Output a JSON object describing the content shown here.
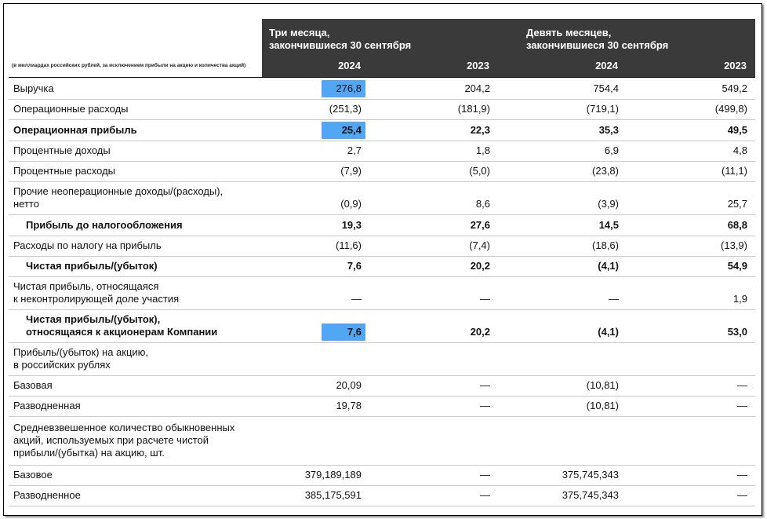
{
  "header": {
    "period_three_months": "Три месяца,\nзакончившиеся 30 сентября",
    "period_nine_months": "Девять месяцев,\nзакончившиеся 30 сентября",
    "years": [
      "2024",
      "2023",
      "2024",
      "2023"
    ],
    "unit_note": "(в миллиардах российских рублей, за исключением прибыли на акцию и количества акций)"
  },
  "highlight_color": "#52a7f5",
  "rows": [
    {
      "label": "Выручка",
      "values": [
        "276,8",
        "204,2",
        "754,4",
        "549,2"
      ],
      "highlight": true
    },
    {
      "label": "Операционные расходы",
      "values": [
        "(251,3)",
        "(181,9)",
        "(719,1)",
        "(499,8)"
      ]
    },
    {
      "label": "Операционная прибыль",
      "values": [
        "25,4",
        "22,3",
        "35,3",
        "49,5"
      ],
      "bold": true,
      "highlight": true
    },
    {
      "label": "Процентные доходы",
      "values": [
        "2,7",
        "1,8",
        "6,9",
        "4,8"
      ]
    },
    {
      "label": "Процентные расходы",
      "values": [
        "(7,9)",
        "(5,0)",
        "(23,8)",
        "(11,1)"
      ]
    },
    {
      "label": "Прочие неоперационные доходы/(расходы),\nнетто",
      "values": [
        "(0,9)",
        "8,6",
        "(3,9)",
        "25,7"
      ]
    },
    {
      "label": "Прибыль до налогообложения",
      "values": [
        "19,3",
        "27,6",
        "14,5",
        "68,8"
      ],
      "bold": true,
      "indent": true
    },
    {
      "label": "Расходы по налогу на прибыль",
      "values": [
        "(11,6)",
        "(7,4)",
        "(18,6)",
        "(13,9)"
      ]
    },
    {
      "label": "Чистая прибыль/(убыток)",
      "values": [
        "7,6",
        "20,2",
        "(4,1)",
        "54,9"
      ],
      "bold": true,
      "indent": true
    },
    {
      "label": "Чистая прибыль, относящаяся\nк неконтролирующей доле участия",
      "values": [
        "—",
        "—",
        "—",
        "1,9"
      ]
    },
    {
      "label": "Чистая прибыль/(убыток),\nотносящаяся к акционерам Компании",
      "values": [
        "7,6",
        "20,2",
        "(4,1)",
        "53,0"
      ],
      "bold": true,
      "indent": true,
      "highlight": true
    },
    {
      "label": "Прибыль/(убыток) на акцию,\nв российских рублях",
      "values": [
        "",
        "",
        "",
        ""
      ]
    },
    {
      "label": "Базовая",
      "values": [
        "20,09",
        "—",
        "(10,81)",
        "—"
      ]
    },
    {
      "label": "Разводненная",
      "values": [
        "19,78",
        "—",
        "(10,81)",
        "—"
      ]
    },
    {
      "label": "Средневзвешенное количество обыкновенных\nакций, используемых при расчете чистой\nприбыли/(убытка) на акцию, шт.",
      "values": [
        "",
        "",
        "",
        ""
      ]
    },
    {
      "label": "Базовое",
      "values": [
        "379,189,189",
        "—",
        "375,745,343",
        "—"
      ]
    },
    {
      "label": "Разводненное",
      "values": [
        "385,175,591",
        "—",
        "375,745,343",
        "—"
      ]
    }
  ]
}
